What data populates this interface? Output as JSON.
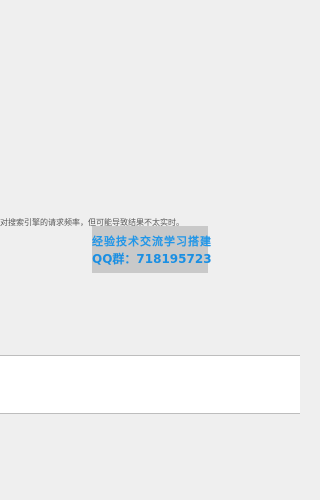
{
  "page": {
    "note_text": "对搜索引擎的请求频率，但可能导致结果不太实时。"
  },
  "watermark": {
    "line1": "经验技术交流学习搭建",
    "line2": "QQ群：718195723",
    "text_color": "#1a8fe3",
    "background_color": "#c9c9c9"
  },
  "colors": {
    "page_background": "#efefef",
    "panel_background": "#ffffff",
    "panel_border": "#bdbdbd"
  }
}
